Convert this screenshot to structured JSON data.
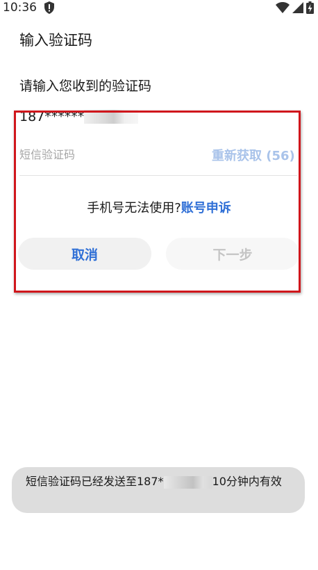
{
  "status_bar": {
    "time": "10:36",
    "icons": [
      "shield-alert-icon",
      "wifi-icon",
      "cellular-signal-icon",
      "battery-charging-icon"
    ]
  },
  "page": {
    "title": "输入验证码",
    "prompt": "请输入您收到的验证码",
    "phone_prefix": "187******"
  },
  "code_field": {
    "placeholder": "短信验证码",
    "value": ""
  },
  "resend_label": "重新获取 (56)",
  "phone_unusable_text": "手机号无法使用?",
  "appeal_link_label": "账号申诉",
  "buttons": {
    "cancel": "取消",
    "next": "下一步"
  },
  "toast": {
    "prefix": "短信验证码已经发送至187*",
    "suffix": "10分钟内有效"
  },
  "colors": {
    "accent_blue": "#2f6fd6",
    "disabled_blue": "#a9c3ea",
    "highlight_red": "#d0161c",
    "toast_bg": "#dddddd"
  }
}
